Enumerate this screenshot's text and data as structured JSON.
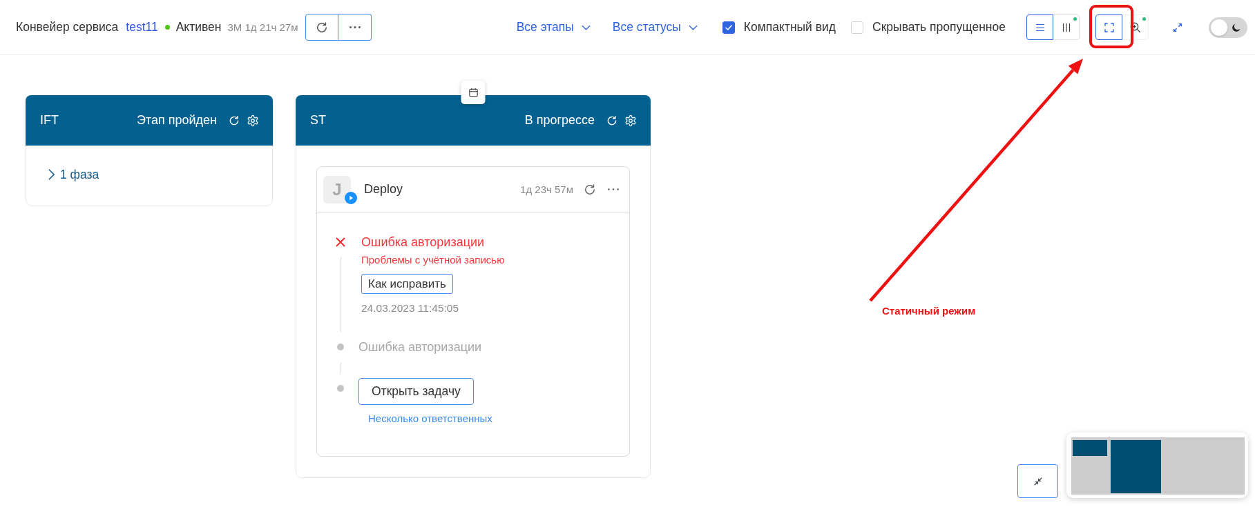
{
  "header": {
    "title": "Конвейер сервиса",
    "service": "test11",
    "status": {
      "label": "Активен",
      "kind": "active"
    },
    "uptime": "3М 1д 21ч 27м"
  },
  "filters": [
    {
      "label": "Все этапы"
    },
    {
      "label": "Все статусы"
    }
  ],
  "options": [
    {
      "label": "Компактный вид",
      "checked": true
    },
    {
      "label": "Скрывать пропущенное",
      "checked": false
    }
  ],
  "view_modes": [
    {
      "kind": "list",
      "selected": true,
      "indicator": false
    },
    {
      "kind": "columns",
      "selected": false,
      "indicator": true
    }
  ],
  "canvas_modes": [
    {
      "kind": "static",
      "selected": true,
      "indicator": false
    },
    {
      "kind": "zoom",
      "selected": false,
      "indicator": true
    }
  ],
  "dark_mode": {
    "on": false
  },
  "stages": [
    {
      "name": "IFT",
      "status": "Этап пройден",
      "calendar": false,
      "phases": [
        {
          "label": "1 фаза",
          "expanded": false
        }
      ]
    },
    {
      "name": "ST",
      "status": "В прогрессе",
      "calendar": true,
      "jobs": [
        {
          "avatar": "J",
          "name": "Deploy",
          "duration": "1д 23ч 57м",
          "steps": [
            {
              "kind": "error",
              "title": "Ошибка авторизации",
              "subtitle": "Проблемы с учётной записью",
              "action": "Как исправить",
              "timestamp": "24.03.2023 11:45:05"
            },
            {
              "kind": "pending",
              "title": "Ошибка авторизации"
            },
            {
              "kind": "action",
              "button": "Открыть задачу",
              "link": "Несколько ответственных"
            }
          ]
        }
      ]
    }
  ],
  "annotation": {
    "text": "Статичный режим"
  }
}
